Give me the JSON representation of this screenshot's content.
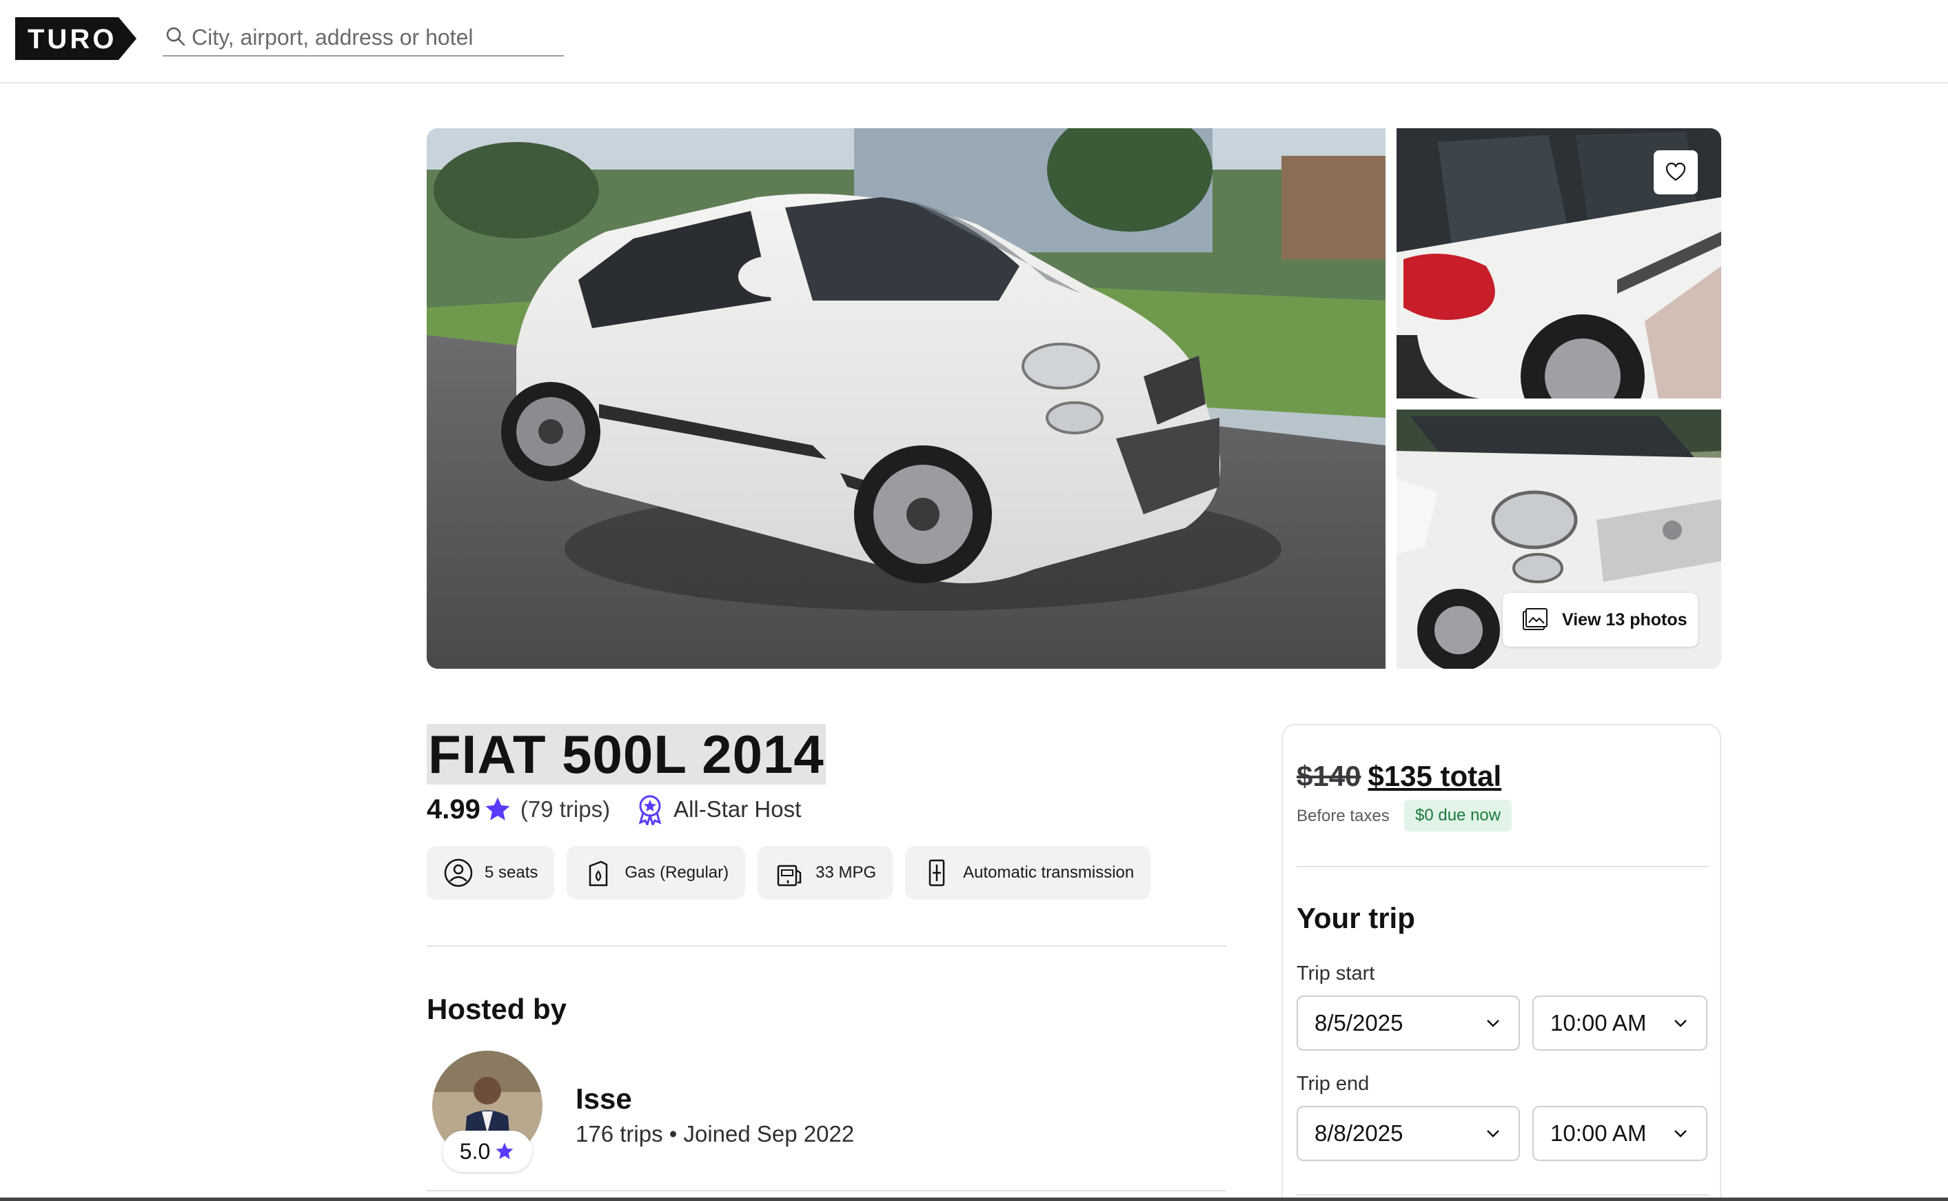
{
  "header": {
    "logo_text": "TURO",
    "search_placeholder": "City, airport, address or hotel"
  },
  "gallery": {
    "view_photos_label": "View 13 photos"
  },
  "vehicle": {
    "title": "FIAT 500L 2014",
    "rating": "4.99",
    "trips": "(79 trips)",
    "host_badge": "All-Star Host"
  },
  "features": [
    {
      "label": "5 seats",
      "icon": "seat-icon"
    },
    {
      "label": "Gas (Regular)",
      "icon": "fuel-icon"
    },
    {
      "label": "33 MPG",
      "icon": "mpg-icon"
    },
    {
      "label": "Automatic transmission",
      "icon": "transmission-icon"
    }
  ],
  "host": {
    "section_title": "Hosted by",
    "name": "Isse",
    "rating": "5.0",
    "trips": "176 trips",
    "joined": "Joined Sep 2022"
  },
  "pricing": {
    "old_price": "$140",
    "total": "$135 total",
    "before_taxes": "Before taxes",
    "due_now": "$0 due now"
  },
  "trip": {
    "title": "Your trip",
    "start_label": "Trip start",
    "start_date": "8/5/2025",
    "start_time": "10:00 AM",
    "end_label": "Trip end",
    "end_date": "8/8/2025",
    "end_time": "10:00 AM"
  },
  "colors": {
    "brand_dark": "#121214",
    "accent_purple": "#593cfb",
    "success_green": "#1b7a3e"
  }
}
